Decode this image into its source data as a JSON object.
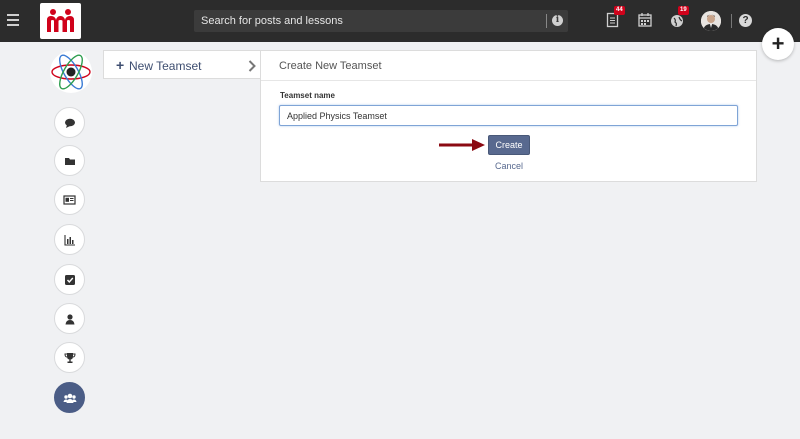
{
  "header": {
    "menu_icon": "hamburger-icon",
    "logo_icon": "brand-logo-icon",
    "search": {
      "placeholder": "Search for posts and lessons",
      "info_icon": "info-icon",
      "info_glyph": "i"
    },
    "notifications": [
      {
        "icon": "document-icon",
        "badge": "44"
      },
      {
        "icon": "calendar-icon",
        "badge": ""
      },
      {
        "icon": "globe-icon",
        "badge": "19"
      }
    ],
    "avatar_icon": "user-avatar",
    "help_icon": "question-icon",
    "help_glyph": "?"
  },
  "fab": {
    "icon": "plus-icon",
    "glyph": "+"
  },
  "rail": {
    "logo_icon": "atom-logo-icon",
    "items": [
      {
        "icon": "comment-icon"
      },
      {
        "icon": "folder-icon"
      },
      {
        "icon": "id-card-icon"
      },
      {
        "icon": "bar-chart-icon"
      },
      {
        "icon": "checkbox-icon"
      },
      {
        "icon": "user-icon"
      },
      {
        "icon": "trophy-icon"
      },
      {
        "icon": "users-icon",
        "active": true
      }
    ]
  },
  "left_panel": {
    "plus_glyph": "+",
    "label": "New Teamset",
    "chevron_icon": "chevron-right-icon"
  },
  "form": {
    "title": "Create New Teamset",
    "field_label": "Teamset name",
    "field_value": "Applied Physics Teamset",
    "create_label": "Create",
    "cancel_label": "Cancel"
  },
  "colors": {
    "topbar": "#2c2c2c",
    "accent": "#58698f",
    "badge": "#d0021b",
    "arrow": "#8b0a12"
  }
}
